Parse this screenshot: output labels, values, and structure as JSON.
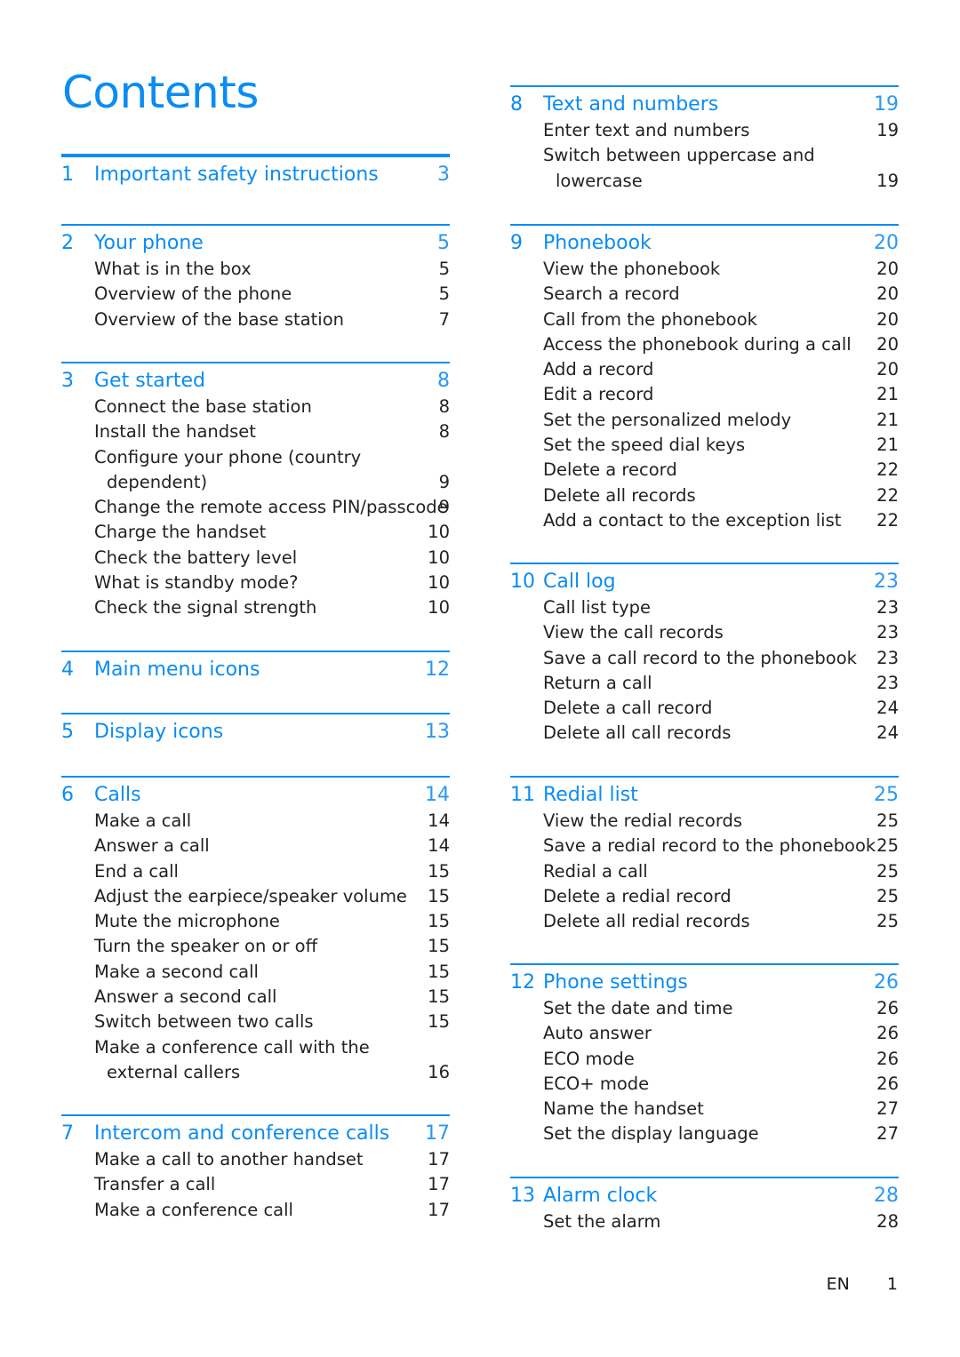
{
  "page_title": "Contents",
  "accent_color": "#0a8cf2",
  "left_column": [
    {
      "number": "1",
      "title": "Important safety instructions",
      "page": "3",
      "items": []
    },
    {
      "number": "2",
      "title": "Your phone",
      "page": "5",
      "items": [
        {
          "label": "What is in the box",
          "page": "5"
        },
        {
          "label": "Overview of the phone",
          "page": "5"
        },
        {
          "label": "Overview of the base station",
          "page": "7"
        }
      ]
    },
    {
      "number": "3",
      "title": "Get started",
      "page": "8",
      "items": [
        {
          "label": "Connect the base station",
          "page": "8"
        },
        {
          "label": "Install the handset",
          "page": "8"
        },
        {
          "label": "Configure your phone (country",
          "continuation": "dependent)",
          "page": "9"
        },
        {
          "label": "Change the remote access PIN/passcode",
          "page": "9"
        },
        {
          "label": "Charge the handset",
          "page": "10"
        },
        {
          "label": "Check the battery level",
          "page": "10"
        },
        {
          "label": "What is standby mode?",
          "page": "10"
        },
        {
          "label": "Check the signal strength",
          "page": "10"
        }
      ]
    },
    {
      "number": "4",
      "title": "Main menu icons",
      "page": "12",
      "items": []
    },
    {
      "number": "5",
      "title": "Display icons",
      "page": "13",
      "items": []
    },
    {
      "number": "6",
      "title": "Calls",
      "page": "14",
      "items": [
        {
          "label": "Make a call",
          "page": "14"
        },
        {
          "label": "Answer a call",
          "page": "14"
        },
        {
          "label": "End a call",
          "page": "15"
        },
        {
          "label": "Adjust the earpiece/speaker volume",
          "page": "15"
        },
        {
          "label": "Mute the microphone",
          "page": "15"
        },
        {
          "label": "Turn the speaker on or off",
          "page": "15"
        },
        {
          "label": "Make a second call",
          "page": "15"
        },
        {
          "label": "Answer a second call",
          "page": "15"
        },
        {
          "label": "Switch between two calls",
          "page": "15"
        },
        {
          "label": "Make a conference call with the",
          "continuation": "external callers",
          "page": "16"
        }
      ]
    },
    {
      "number": "7",
      "title": "Intercom and conference calls",
      "page": "17",
      "items": [
        {
          "label": "Make a call to another handset",
          "page": "17"
        },
        {
          "label": "Transfer a call",
          "page": "17"
        },
        {
          "label": "Make a conference call",
          "page": "17"
        }
      ]
    }
  ],
  "right_column": [
    {
      "number": "8",
      "title": "Text and numbers",
      "page": "19",
      "items": [
        {
          "label": "Enter text and numbers",
          "page": "19"
        },
        {
          "label": "Switch between uppercase and",
          "continuation": "lowercase",
          "page": "19"
        }
      ]
    },
    {
      "number": "9",
      "title": "Phonebook",
      "page": "20",
      "items": [
        {
          "label": "View the phonebook",
          "page": "20"
        },
        {
          "label": "Search a record",
          "page": "20"
        },
        {
          "label": "Call from the phonebook",
          "page": "20"
        },
        {
          "label": "Access the phonebook during a call",
          "page": "20"
        },
        {
          "label": "Add a record",
          "page": "20"
        },
        {
          "label": "Edit a record",
          "page": "21"
        },
        {
          "label": "Set the personalized melody",
          "page": "21"
        },
        {
          "label": "Set the speed dial keys",
          "page": "21"
        },
        {
          "label": "Delete a record",
          "page": "22"
        },
        {
          "label": "Delete all records",
          "page": "22"
        },
        {
          "label": "Add a contact to the exception list",
          "page": "22"
        }
      ]
    },
    {
      "number": "10",
      "title": "Call log",
      "page": "23",
      "items": [
        {
          "label": "Call list type",
          "page": "23"
        },
        {
          "label": "View the call records",
          "page": "23"
        },
        {
          "label": "Save a call record to the phonebook",
          "page": "23"
        },
        {
          "label": "Return a call",
          "page": "23"
        },
        {
          "label": "Delete a call record",
          "page": "24"
        },
        {
          "label": "Delete all call records",
          "page": "24"
        }
      ]
    },
    {
      "number": "11",
      "title": "Redial list",
      "page": "25",
      "items": [
        {
          "label": "View the redial records",
          "page": "25"
        },
        {
          "label": "Save a redial record to the phonebook",
          "page": "25"
        },
        {
          "label": "Redial a call",
          "page": "25"
        },
        {
          "label": "Delete a redial record",
          "page": "25"
        },
        {
          "label": "Delete all redial records",
          "page": "25"
        }
      ]
    },
    {
      "number": "12",
      "title": "Phone settings",
      "page": "26",
      "items": [
        {
          "label": "Set the date and time",
          "page": "26"
        },
        {
          "label": "Auto answer",
          "page": "26"
        },
        {
          "label": "ECO mode",
          "page": "26"
        },
        {
          "label": "ECO+ mode",
          "page": "26"
        },
        {
          "label": "Name the handset",
          "page": "27"
        },
        {
          "label": "Set the display language",
          "page": "27"
        }
      ]
    },
    {
      "number": "13",
      "title": "Alarm clock",
      "page": "28",
      "items": [
        {
          "label": "Set the alarm",
          "page": "28"
        }
      ]
    }
  ],
  "footer": {
    "language": "EN",
    "page_number": "1"
  }
}
